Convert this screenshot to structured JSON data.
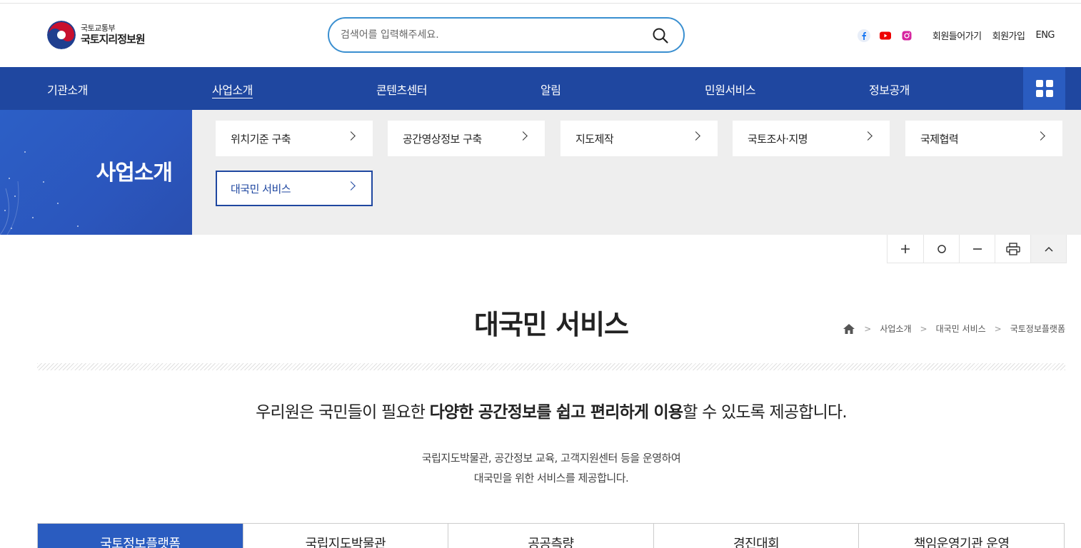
{
  "header": {
    "logo_sub": "국토교통부",
    "logo_main": "국토지리정보원",
    "search_placeholder": "검색어를 입력해주세요.",
    "util_links": [
      "회원들어가기",
      "회원가입",
      "ENG"
    ]
  },
  "gnb": {
    "items": [
      "기관소개",
      "사업소개",
      "콘텐츠센터",
      "알림",
      "민원서비스",
      "정보공개"
    ],
    "active": "사업소개"
  },
  "sub_visual": {
    "title": "사업소개",
    "buttons": [
      "위치기준 구축",
      "공간영상정보 구축",
      "지도제작",
      "국토조사·지명",
      "국제협력",
      "대국민 서비스"
    ],
    "active": "대국민 서비스"
  },
  "page": {
    "title": "대국민 서비스",
    "breadcrumb": [
      "사업소개",
      "대국민 서비스",
      "국토정보플랫폼"
    ],
    "lead_pre": "우리원은 국민들이 필요한 ",
    "lead_bold": "다양한 공간정보를 쉽고 편리하게 이용",
    "lead_post": "할 수 있도록 제공합니다.",
    "desc_line1": "국립지도박물관, 공간정보 교육, 고객지원센터 등을 운영하여",
    "desc_line2": "대국민을 위한 서비스를 제공합니다."
  },
  "tabs": [
    "국토정보플랫폼",
    "국립지도박물관",
    "공공측량",
    "경진대회",
    "책임운영기관 운영"
  ],
  "colors": {
    "primary": "#1f47a0",
    "accent": "#2a5cc0",
    "search_border": "#3a8fd0"
  },
  "icons": [
    "facebook-icon",
    "youtube-icon",
    "instagram-icon",
    "search-icon",
    "grid-menu-icon",
    "home-icon",
    "zoom-in-icon",
    "reset-icon",
    "zoom-out-icon",
    "print-icon",
    "scroll-top-icon"
  ]
}
